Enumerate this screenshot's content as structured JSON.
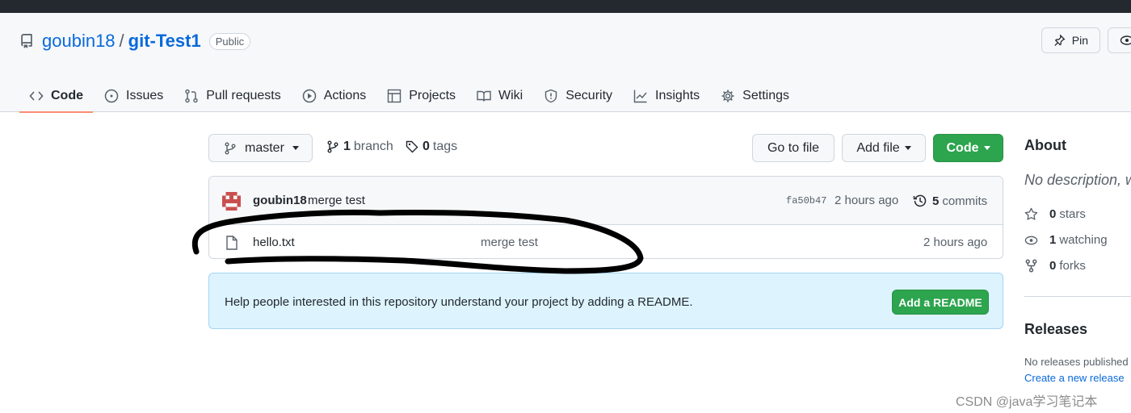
{
  "repo": {
    "owner": "goubin18",
    "separator": "/",
    "name": "git-Test1",
    "visibility": "Public",
    "pin_label": "Pin"
  },
  "tabs": [
    {
      "label": "Code",
      "icon": "code-icon",
      "selected": true
    },
    {
      "label": "Issues",
      "icon": "issue-icon"
    },
    {
      "label": "Pull requests",
      "icon": "pull-request-icon"
    },
    {
      "label": "Actions",
      "icon": "play-icon"
    },
    {
      "label": "Projects",
      "icon": "table-icon"
    },
    {
      "label": "Wiki",
      "icon": "book-icon"
    },
    {
      "label": "Security",
      "icon": "shield-icon"
    },
    {
      "label": "Insights",
      "icon": "graph-icon"
    },
    {
      "label": "Settings",
      "icon": "gear-icon"
    }
  ],
  "toolbar": {
    "branch": "master",
    "branch_count": "1",
    "branch_label": "branch",
    "tag_count": "0",
    "tag_label": "tags",
    "goto_file": "Go to file",
    "add_file": "Add file",
    "code": "Code"
  },
  "commit": {
    "author": "goubin18",
    "message": "merge test",
    "sha": "fa50b47",
    "time": "2 hours ago",
    "commit_count": "5",
    "commits_label": "commits"
  },
  "files": [
    {
      "name": "hello.txt",
      "commit_message": "merge test",
      "time": "2 hours ago",
      "icon": "file-icon"
    }
  ],
  "readme": {
    "message": "Help people interested in this repository understand your project by adding a README.",
    "button": "Add a README"
  },
  "about": {
    "title": "About",
    "description": "No description, w",
    "stars_count": "0",
    "stars_label": "stars",
    "watching_count": "1",
    "watching_label": "watching",
    "forks_count": "0",
    "forks_label": "forks"
  },
  "releases": {
    "title": "Releases",
    "none": "No releases published",
    "create": "Create a new release"
  },
  "watermark": "CSDN @java学习笔记本",
  "colors": {
    "accent_green": "#2da44e",
    "link_blue": "#0969da",
    "tab_underline": "#fd8c73",
    "banner_bg": "#ddf4ff"
  }
}
